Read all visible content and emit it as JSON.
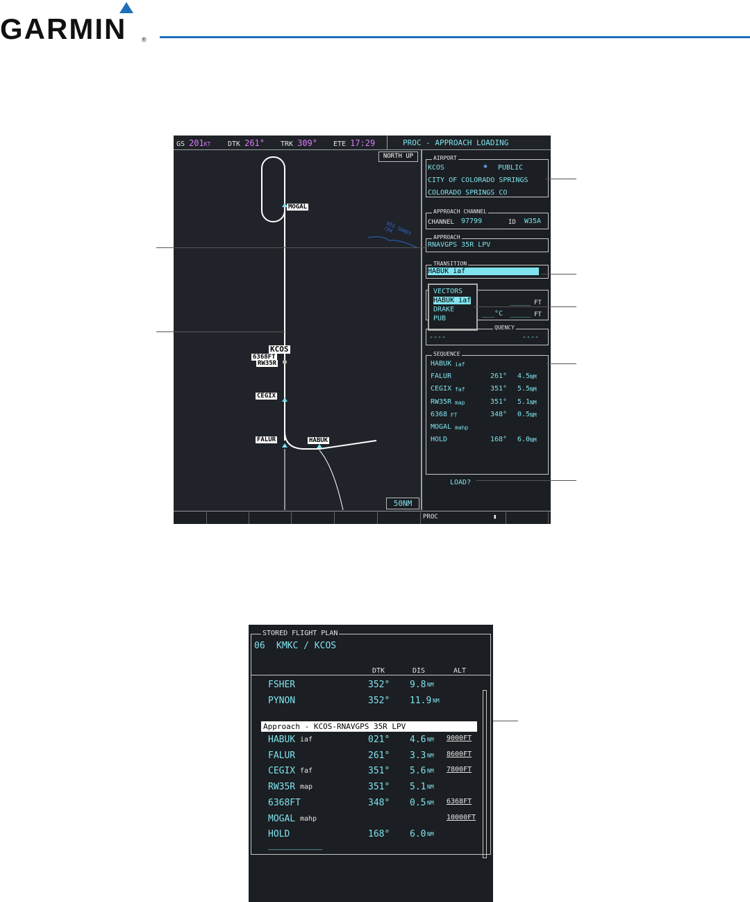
{
  "header": {
    "brand": "GARMIN",
    "reg": "®"
  },
  "mfd": {
    "topbar": {
      "gs_label": "GS",
      "gs_value": "201",
      "gs_unit": "KT",
      "dtk_label": "DTK",
      "dtk_value": "261°",
      "trk_label": "TRK",
      "trk_value": "309°",
      "ete_label": "ETE",
      "ete_value": "17:29",
      "page_title": "PROC - APPROACH LOADING"
    },
    "map": {
      "orientation": "NORTH UP",
      "range": "50NM",
      "waypoints": {
        "mogal": "MOGAL",
        "kcos": "KCOS",
        "alt6368": "6368FT",
        "rw35r": "RW35R",
        "cegix": "CEGIX",
        "falur": "FALUR",
        "habuk": "HABUK"
      },
      "river_label": "BIG SANDY CRK"
    },
    "airport": {
      "title": "AIRPORT",
      "ident": "KCOS",
      "type": "PUBLIC",
      "name": "CITY OF COLORADO SPRINGS",
      "city": "COLORADO SPRINGS CO"
    },
    "channel": {
      "title": "APPROACH CHANNEL",
      "channel_label": "CHANNEL",
      "channel_value": "97799",
      "id_label": "ID",
      "id_value": "W35A"
    },
    "approach": {
      "title": "APPROACH",
      "value": "RNAVGPS 35R LPV"
    },
    "transition": {
      "title": "TRANSITION",
      "value": "HABUK iaf",
      "options": [
        "VECTORS",
        "HABUK iaf",
        "DRAKE",
        "PUB"
      ],
      "selected_index": 1
    },
    "minimums": {
      "row1_unit": "FT",
      "row1_value": "_____",
      "row2_unit": "FT",
      "row2_value": "_____",
      "row2_c": "___°C"
    },
    "frequency": {
      "title": "QUENCY",
      "left": "----",
      "right": "----"
    },
    "sequence": {
      "title": "SEQUENCE",
      "rows": [
        {
          "name": "HABUK",
          "tag": "iaf",
          "dtk": "",
          "dis": "",
          "unit": ""
        },
        {
          "name": "FALUR",
          "tag": "",
          "dtk": "261°",
          "dis": "4.5",
          "unit": "NM"
        },
        {
          "name": "CEGIX",
          "tag": "faf",
          "dtk": "351°",
          "dis": "5.5",
          "unit": "NM"
        },
        {
          "name": "RW35R",
          "tag": "map",
          "dtk": "351°",
          "dis": "5.1",
          "unit": "NM"
        },
        {
          "name": "6368",
          "tag": "FT",
          "dtk": "348°",
          "dis": "0.5",
          "unit": "NM"
        },
        {
          "name": "MOGAL",
          "tag": "mahp",
          "dtk": "",
          "dis": "",
          "unit": ""
        },
        {
          "name": "HOLD",
          "tag": "",
          "dtk": "168°",
          "dis": "6.0",
          "unit": "NM"
        }
      ]
    },
    "load_prompt": "LOAD?",
    "statusbar": {
      "label": "PROC",
      "mark": "▮"
    }
  },
  "stored_flight_plan": {
    "title": "STORED FLIGHT PLAN",
    "number": "06",
    "route": "KMKC / KCOS",
    "columns": {
      "dtk": "DTK",
      "dis": "DIS",
      "alt": "ALT"
    },
    "rows_top": [
      {
        "name": "FSHER",
        "tag": "",
        "dtk": "352°",
        "dis": "9.8",
        "unit": "NM",
        "alt": ""
      },
      {
        "name": "PYNON",
        "tag": "",
        "dtk": "352°",
        "dis": "11.9",
        "unit": "NM",
        "alt": ""
      }
    ],
    "approach_header": "Approach - KCOS-RNAVGPS 35R LPV",
    "rows": [
      {
        "name": "HABUK",
        "tag": "iaf",
        "dtk": "021°",
        "dis": "4.6",
        "unit": "NM",
        "alt": "9000FT"
      },
      {
        "name": "FALUR",
        "tag": "",
        "dtk": "261°",
        "dis": "3.3",
        "unit": "NM",
        "alt": "8600FT"
      },
      {
        "name": "CEGIX",
        "tag": "faf",
        "dtk": "351°",
        "dis": "5.6",
        "unit": "NM",
        "alt": "7800FT"
      },
      {
        "name": "RW35R",
        "tag": "map",
        "dtk": "351°",
        "dis": "5.1",
        "unit": "NM",
        "alt": ""
      },
      {
        "name": "6368FT",
        "tag": "",
        "dtk": "348°",
        "dis": "0.5",
        "unit": "NM",
        "alt": "6368FT"
      },
      {
        "name": "MOGAL",
        "tag": "mahp",
        "dtk": "",
        "dis": "",
        "unit": "",
        "alt": "10000FT"
      },
      {
        "name": "HOLD",
        "tag": "",
        "dtk": "168°",
        "dis": "6.0",
        "unit": "NM",
        "alt": ""
      }
    ],
    "empty_row": "__________"
  },
  "colors": {
    "accent": "#1e6fb8",
    "cyan": "#7fe3ee",
    "magenta": "#d97cff",
    "screen": "#1b1e22"
  }
}
